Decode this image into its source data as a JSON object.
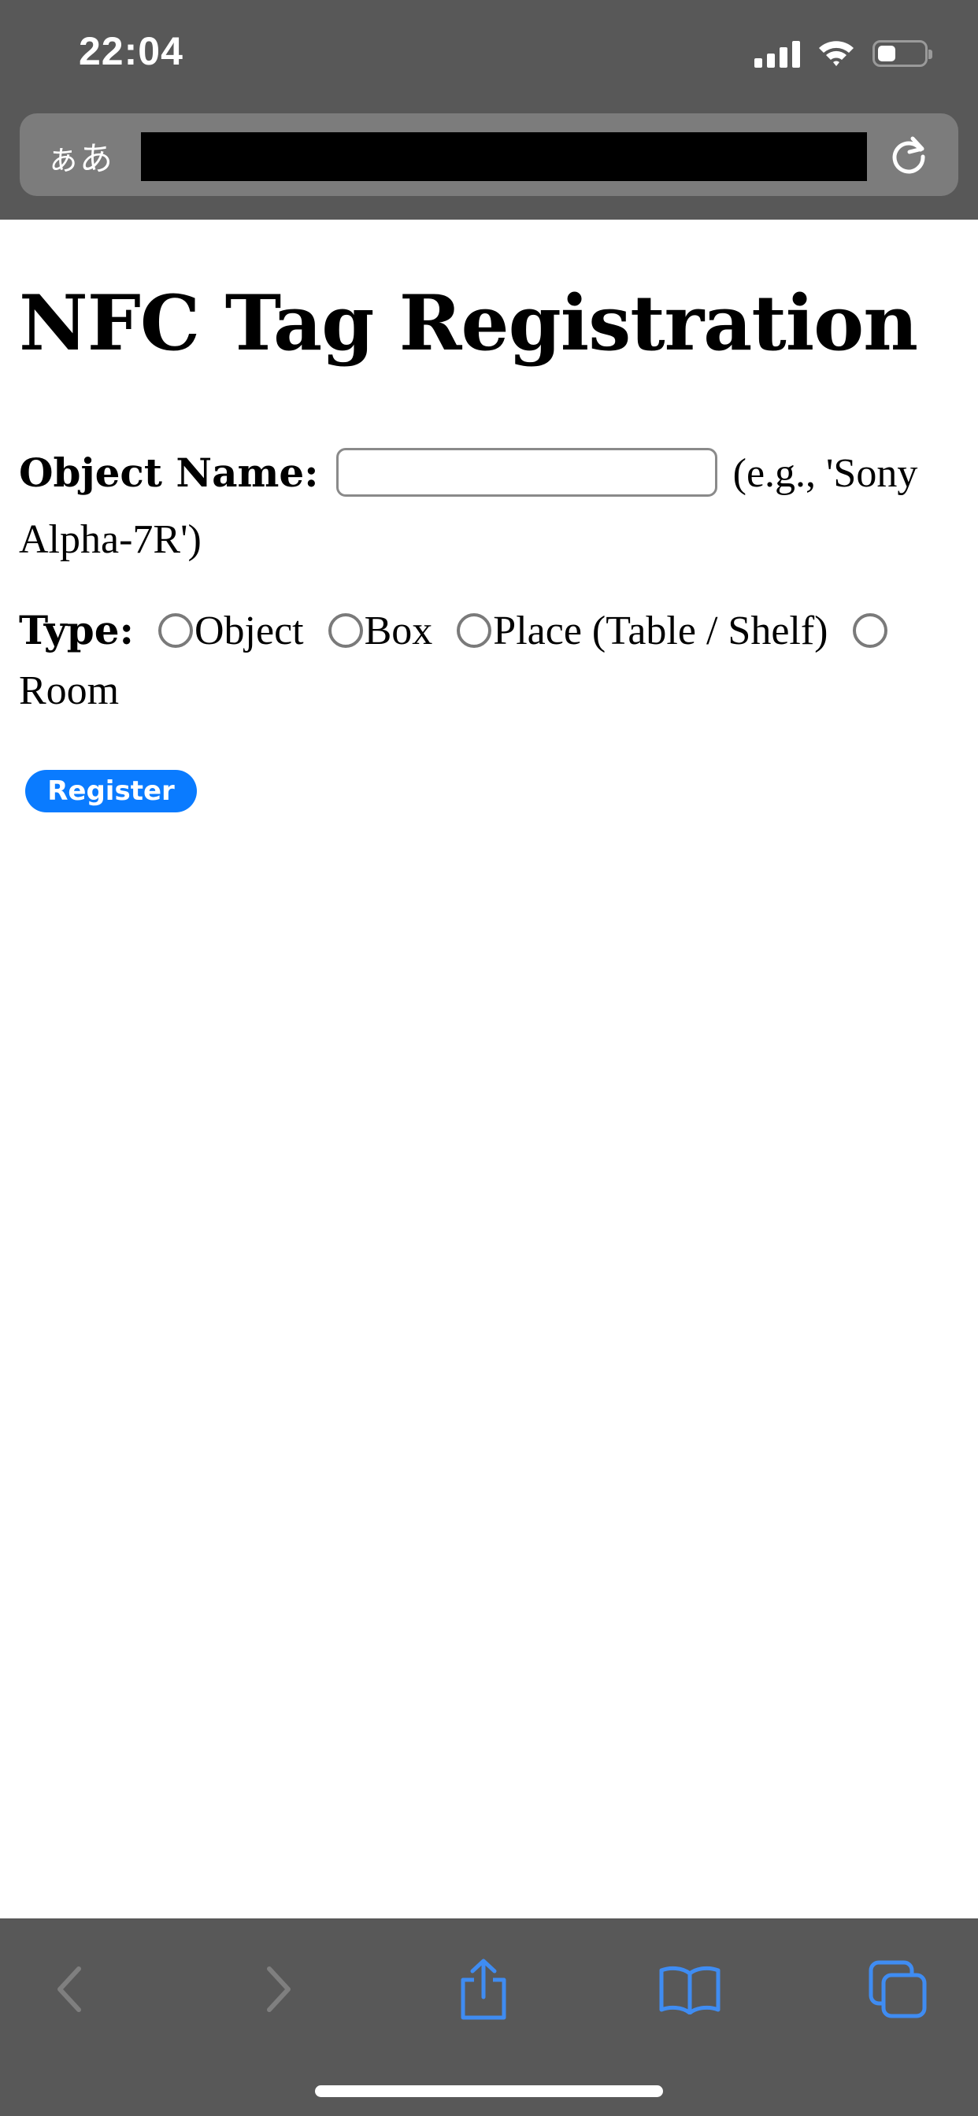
{
  "status_bar": {
    "time": "22:04",
    "battery_level": 0.4
  },
  "browser": {
    "text_size_label": "ぁあ",
    "url_redacted": true,
    "icons": [
      "signal-icon",
      "wifi-icon",
      "battery-icon",
      "reload-icon",
      "back-icon",
      "forward-icon",
      "share-icon",
      "bookmarks-icon",
      "tabs-icon"
    ]
  },
  "page": {
    "title": "NFC Tag Registration",
    "object_name": {
      "label": "Object Name:",
      "value": "",
      "hint": "(e.g., 'Sony Alpha-7R')"
    },
    "type": {
      "label": "Type:",
      "options": [
        "Object",
        "Box",
        "Place (Table / Shelf)",
        "Room"
      ]
    },
    "register_label": "Register"
  },
  "colors": {
    "chrome": "#585858",
    "url_field": "#7c7c7c",
    "accent": "#0a7bff",
    "toolbar_icon": "#3f8cf2",
    "disabled_icon": "#7f7f7f"
  }
}
